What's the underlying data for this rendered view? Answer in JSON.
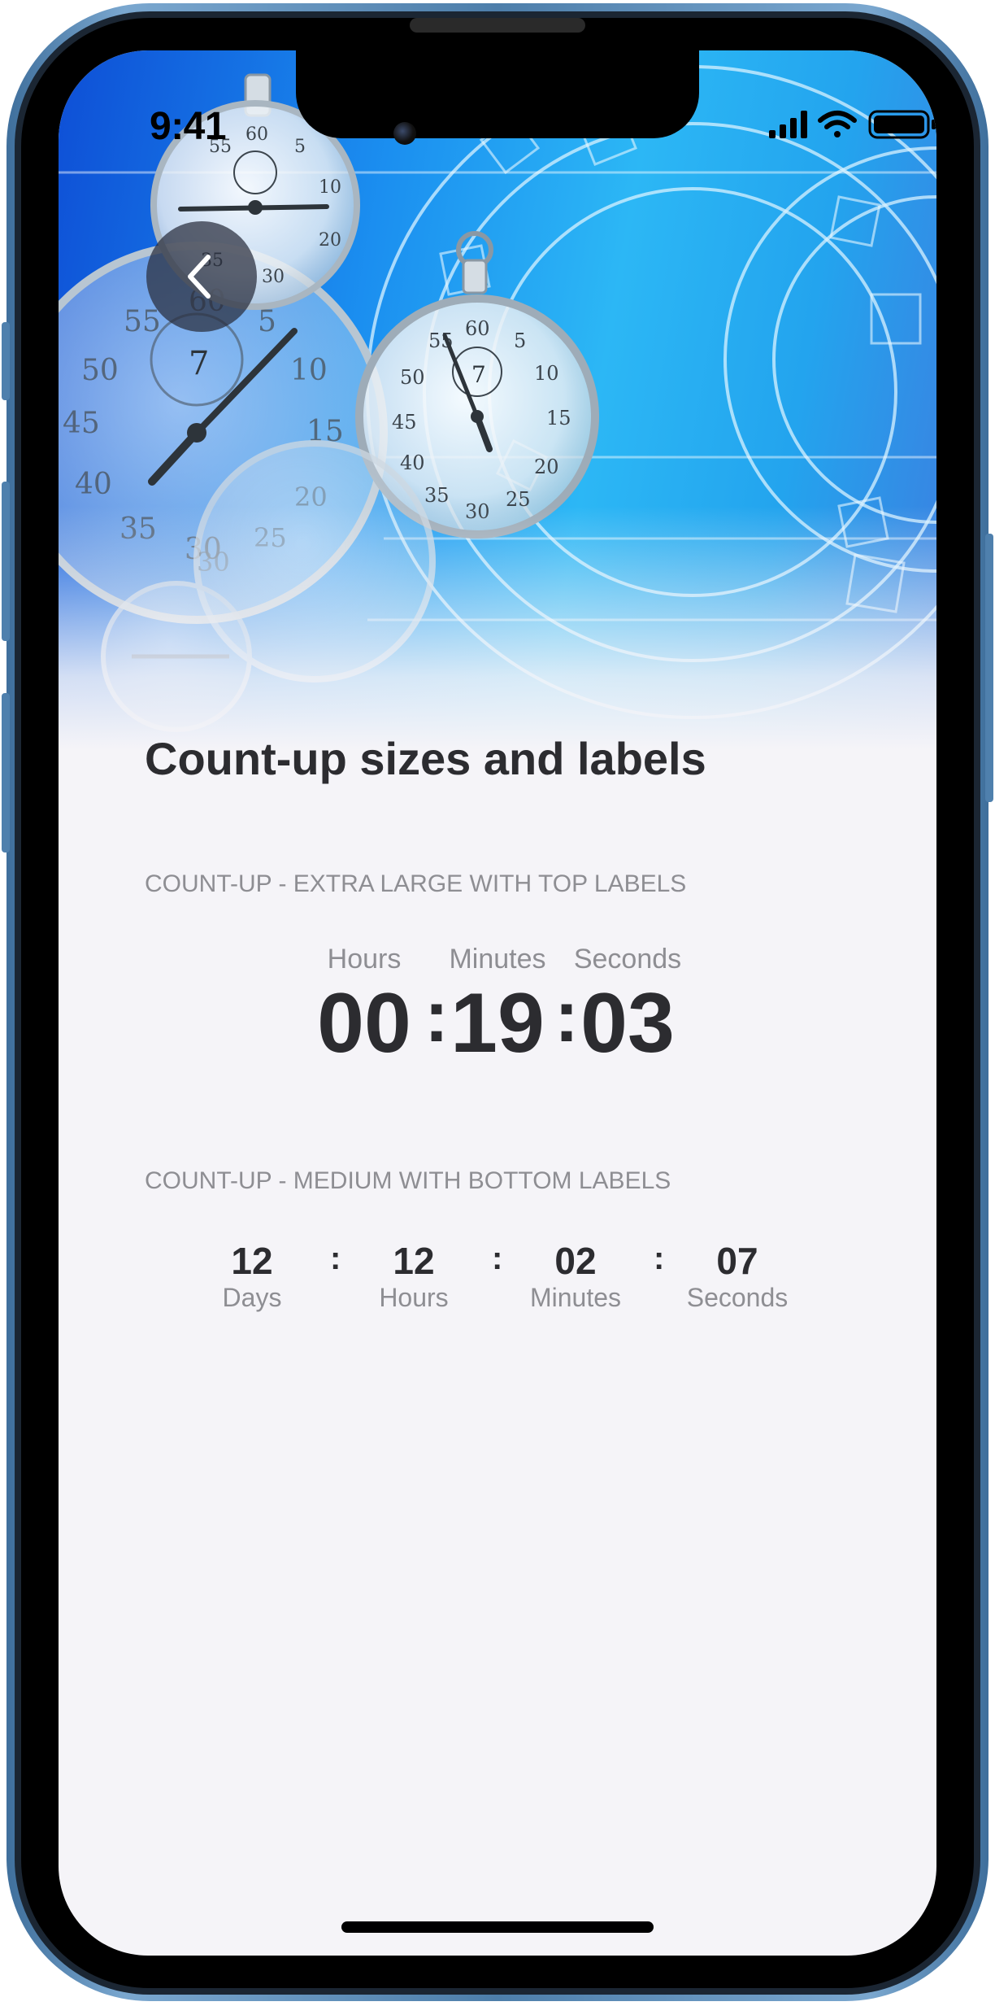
{
  "status_bar": {
    "time": "9:41",
    "icons": [
      "signal-icon",
      "wifi-icon",
      "battery-icon"
    ]
  },
  "nav": {
    "back_icon": "chevron-left-icon"
  },
  "page": {
    "title": "Count-up sizes and labels"
  },
  "countup_xl": {
    "header": "COUNT-UP - EXTRA LARGE WITH TOP LABELS",
    "separator": ":",
    "units": [
      {
        "label": "Hours",
        "value": "00"
      },
      {
        "label": "Minutes",
        "value": "19"
      },
      {
        "label": "Seconds",
        "value": "03"
      }
    ]
  },
  "countup_medium": {
    "header": "COUNT-UP - MEDIUM WITH BOTTOM LABELS",
    "separator": ":",
    "units": [
      {
        "label": "Days",
        "value": "12"
      },
      {
        "label": "Hours",
        "value": "12"
      },
      {
        "label": "Minutes",
        "value": "02"
      },
      {
        "label": "Seconds",
        "value": "07"
      }
    ]
  },
  "colors": {
    "text_primary": "#2c2c30",
    "text_secondary": "#8e8e93",
    "background": "#f5f4f8",
    "frame_blue": "#4d7eaa"
  }
}
